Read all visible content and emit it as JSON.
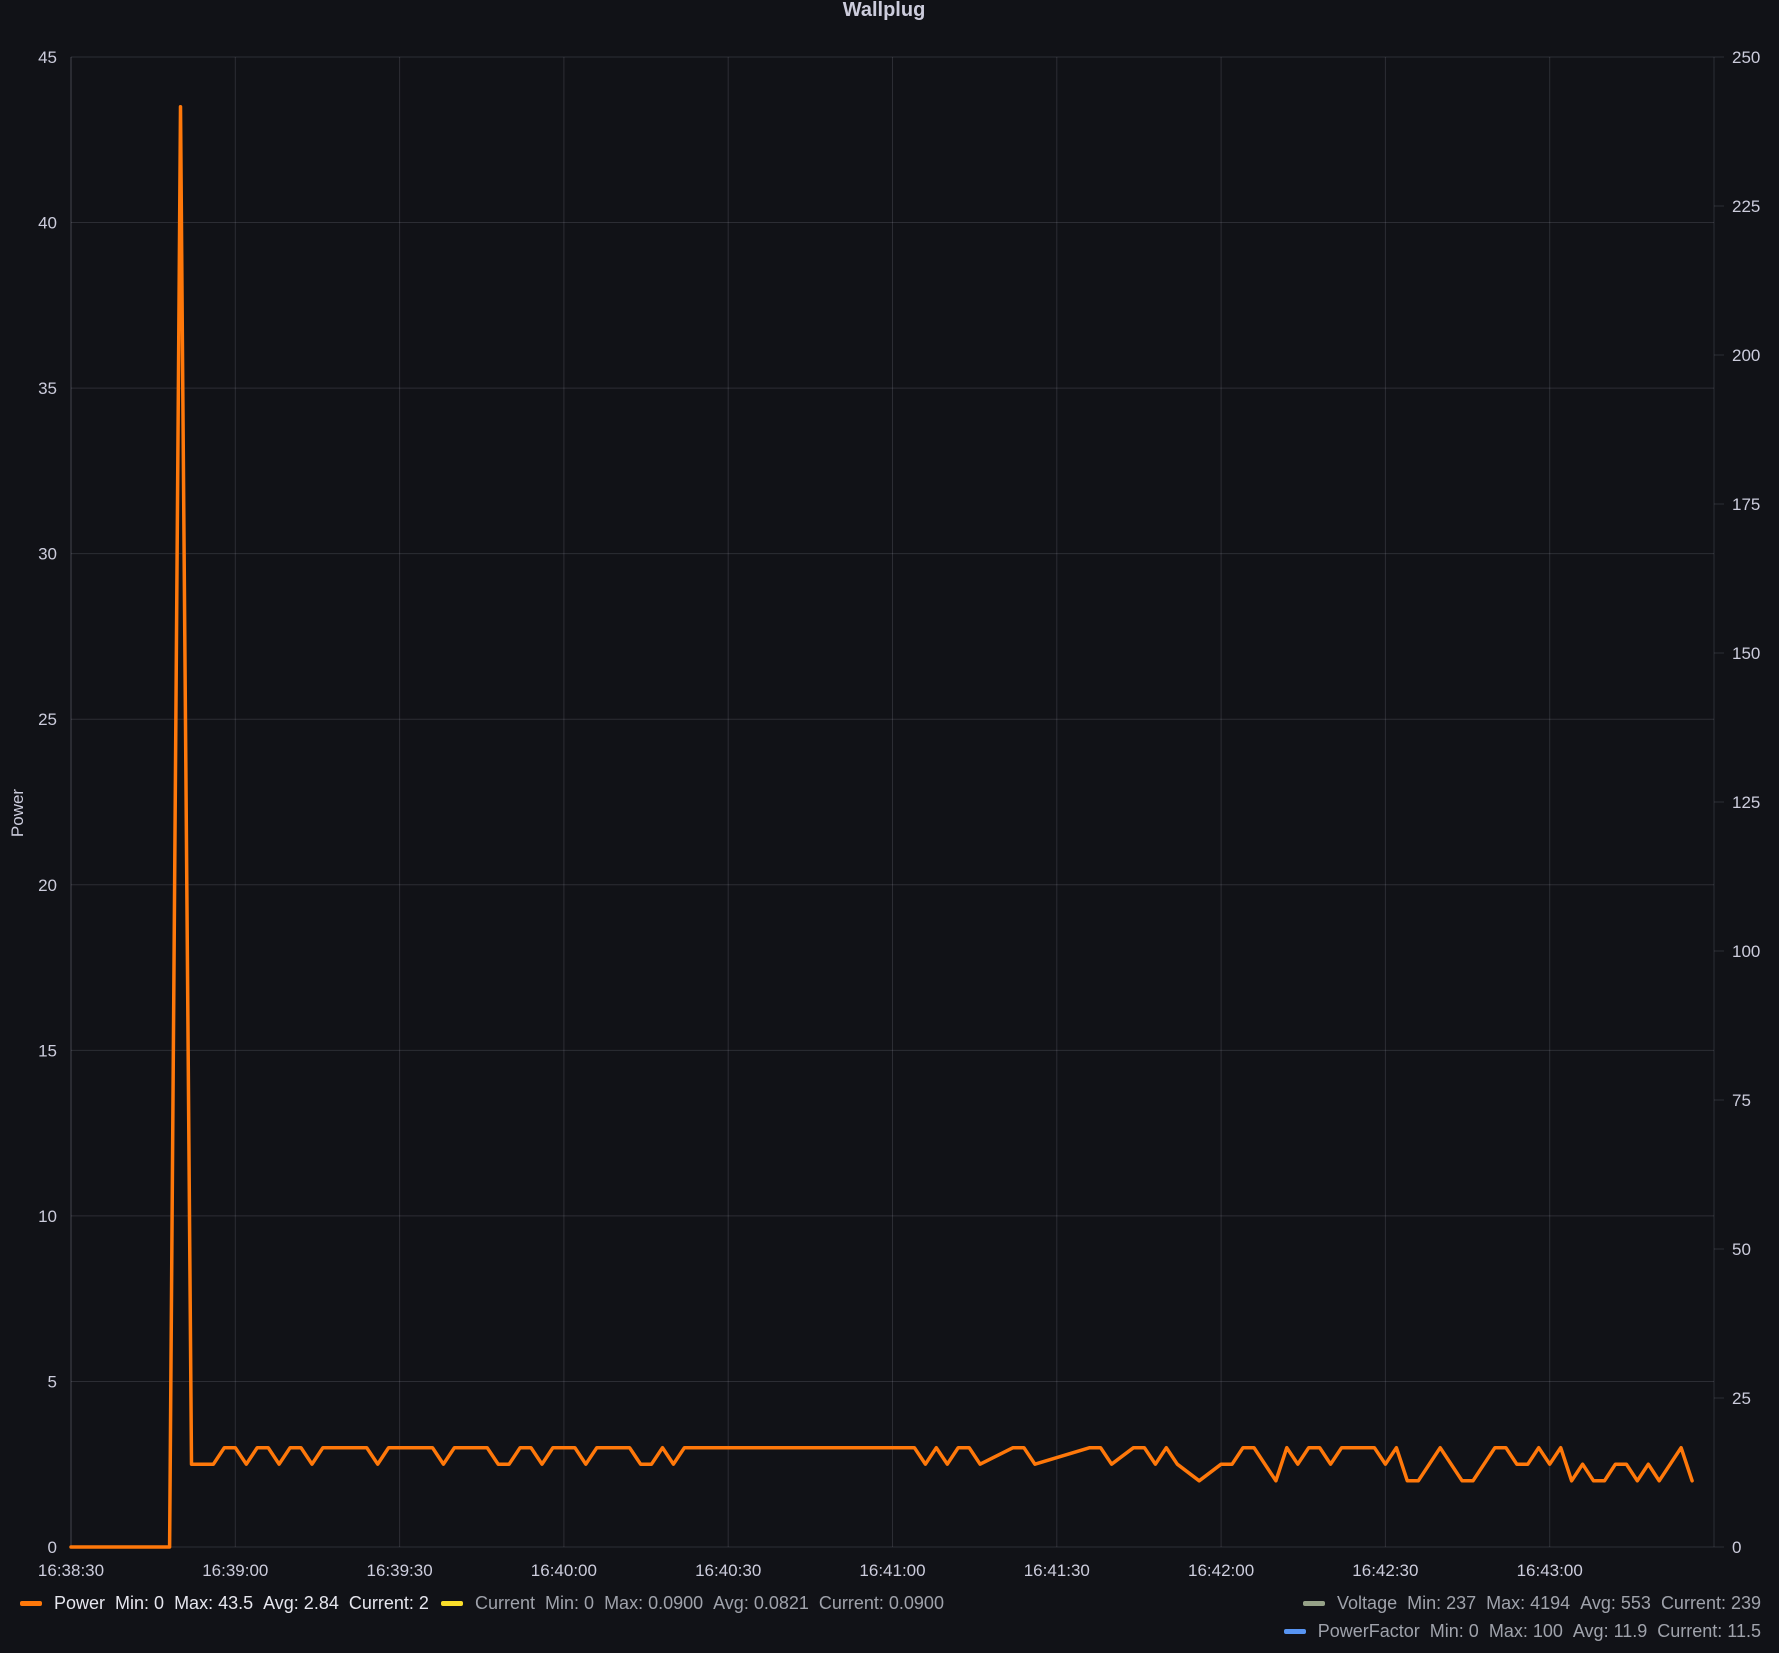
{
  "chart_data": {
    "type": "line",
    "title": "Wallplug",
    "ylabel": "Power",
    "ylim": [
      0,
      45
    ],
    "y_ticks": [
      "0",
      "5",
      "10",
      "15",
      "20",
      "25",
      "30",
      "35",
      "40",
      "45"
    ],
    "y2lim": [
      0,
      250
    ],
    "y2_ticks": [
      "0",
      "25",
      "50",
      "75",
      "100",
      "125",
      "150",
      "175",
      "200",
      "225",
      "250"
    ],
    "x_ticks": [
      "16:38:30",
      "16:39:00",
      "16:39:30",
      "16:40:00",
      "16:40:30",
      "16:41:00",
      "16:41:30",
      "16:42:00",
      "16:42:30",
      "16:43:00"
    ],
    "xlim": [
      "16:38:30",
      "16:43:30"
    ],
    "grid": true,
    "legend_position": "bottom",
    "series": [
      {
        "name": "Power",
        "color": "#ff780a",
        "visible": true,
        "x": [
          "16:38:30",
          "16:38:48",
          "16:38:50",
          "16:38:52",
          "16:38:54",
          "16:38:56",
          "16:38:58",
          "16:39:00",
          "16:39:02",
          "16:39:04",
          "16:39:06",
          "16:39:08",
          "16:39:10",
          "16:39:12",
          "16:39:14",
          "16:39:16",
          "16:39:24",
          "16:39:26",
          "16:39:28",
          "16:39:36",
          "16:39:38",
          "16:39:40",
          "16:39:46",
          "16:39:48",
          "16:39:50",
          "16:39:52",
          "16:39:54",
          "16:39:56",
          "16:39:58",
          "16:40:02",
          "16:40:04",
          "16:40:06",
          "16:40:12",
          "16:40:14",
          "16:40:16",
          "16:40:18",
          "16:40:20",
          "16:40:22",
          "16:41:04",
          "16:41:06",
          "16:41:08",
          "16:41:10",
          "16:41:12",
          "16:41:14",
          "16:41:16",
          "16:41:22",
          "16:41:24",
          "16:41:26",
          "16:41:36",
          "16:41:38",
          "16:41:40",
          "16:41:44",
          "16:41:46",
          "16:41:48",
          "16:41:50",
          "16:41:52",
          "16:41:56",
          "16:42:00",
          "16:42:02",
          "16:42:04",
          "16:42:06",
          "16:42:10",
          "16:42:12",
          "16:42:14",
          "16:42:16",
          "16:42:18",
          "16:42:20",
          "16:42:22",
          "16:42:28",
          "16:42:30",
          "16:42:32",
          "16:42:34",
          "16:42:36",
          "16:42:40",
          "16:42:44",
          "16:42:46",
          "16:42:50",
          "16:42:52",
          "16:42:54",
          "16:42:56",
          "16:42:58",
          "16:43:00",
          "16:43:02",
          "16:43:04",
          "16:43:06",
          "16:43:08",
          "16:43:10",
          "16:43:12",
          "16:43:14",
          "16:43:16",
          "16:43:18",
          "16:43:20",
          "16:43:22",
          "16:43:24",
          "16:43:26"
        ],
        "y": [
          0,
          0,
          43.5,
          2.5,
          2.5,
          2.5,
          3,
          3,
          2.5,
          3,
          3,
          2.5,
          3,
          3,
          2.5,
          3,
          3,
          2.5,
          3,
          3,
          2.5,
          3,
          3,
          2.5,
          2.5,
          3,
          3,
          2.5,
          3,
          3,
          2.5,
          3,
          3,
          2.5,
          2.5,
          3,
          2.5,
          3,
          3,
          2.5,
          3,
          2.5,
          3,
          3,
          2.5,
          3,
          3,
          2.5,
          3,
          3,
          2.5,
          3,
          3,
          2.5,
          3,
          2.5,
          2,
          2.5,
          2.5,
          3,
          3,
          2,
          3,
          2.5,
          3,
          3,
          2.5,
          3,
          3,
          2.5,
          3,
          2,
          2,
          3,
          2,
          2,
          3,
          3,
          2.5,
          2.5,
          3,
          2.5,
          3,
          2,
          2.5,
          2,
          2,
          2.5,
          2.5,
          2,
          2.5,
          2,
          2.5,
          3,
          2
        ]
      },
      {
        "name": "Current",
        "color": "#fade2a",
        "visible": false
      },
      {
        "name": "Voltage",
        "color": "#8ab8a2",
        "visible": false
      },
      {
        "name": "PowerFactor",
        "color": "#5794f2",
        "visible": false
      }
    ]
  },
  "legend": [
    {
      "name": "Power",
      "color": "#ff780a",
      "min": "Min: 0",
      "max": "Max: 43.5",
      "avg": "Avg: 2.84",
      "current": "Current: 2"
    },
    {
      "name": "Current",
      "color": "#fade2a",
      "min": "Min: 0",
      "max": "Max: 0.0900",
      "avg": "Avg: 0.0821",
      "current": "Current: 0.0900"
    },
    {
      "name": "Voltage",
      "color": "#96a288",
      "min": "Min: 237",
      "max": "Max: 4194",
      "avg": "Avg: 553",
      "current": "Current: 239"
    },
    {
      "name": "PowerFactor",
      "color": "#5794f2",
      "min": "Min: 0",
      "max": "Max: 100",
      "avg": "Avg: 11.9",
      "current": "Current: 11.5"
    }
  ]
}
